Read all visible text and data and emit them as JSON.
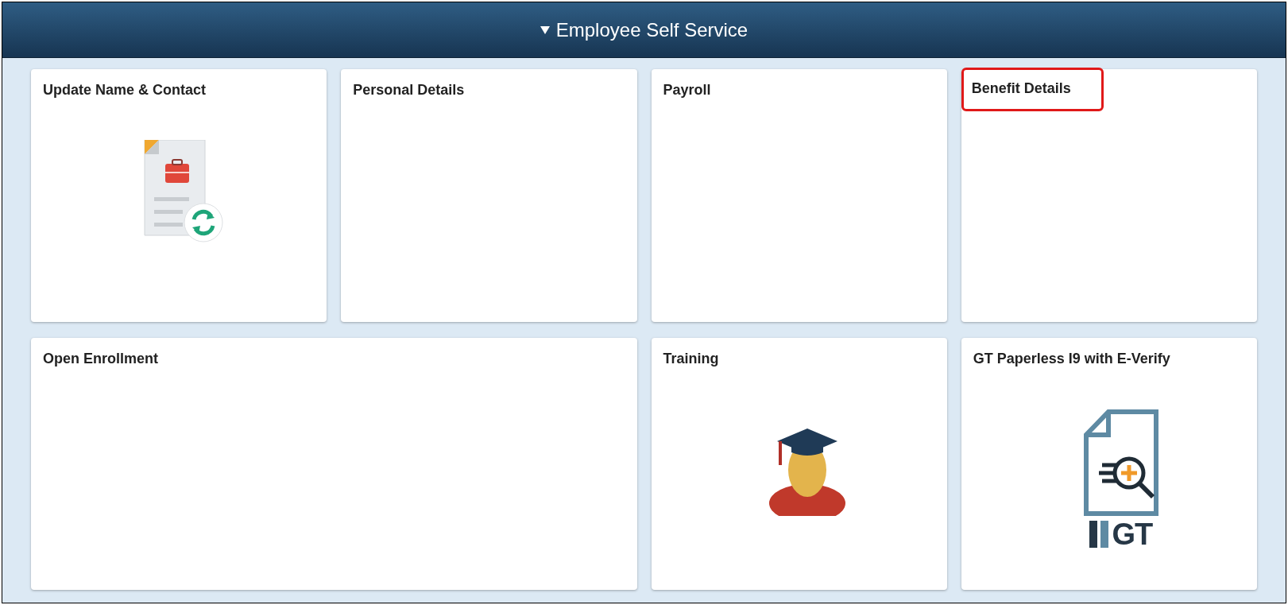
{
  "header": {
    "title": "Employee Self Service",
    "expanded": true
  },
  "tiles": [
    {
      "title": "Update Name & Contact",
      "kind": "contact",
      "wide": false,
      "highlighted": false
    },
    {
      "title": "Personal Details",
      "kind": "blank",
      "wide": false,
      "highlighted": false
    },
    {
      "title": "Payroll",
      "kind": "blank",
      "wide": false,
      "highlighted": false
    },
    {
      "title": "Benefit Details",
      "kind": "blank",
      "wide": false,
      "highlighted": true
    },
    {
      "title": "Open Enrollment",
      "kind": "blank",
      "wide": true,
      "highlighted": false
    },
    {
      "title": "Training",
      "kind": "training",
      "wide": false,
      "highlighted": false
    },
    {
      "title": "GT Paperless I9 with E-Verify",
      "kind": "everify",
      "wide": false,
      "highlighted": false,
      "logo_text": "GT"
    }
  ]
}
